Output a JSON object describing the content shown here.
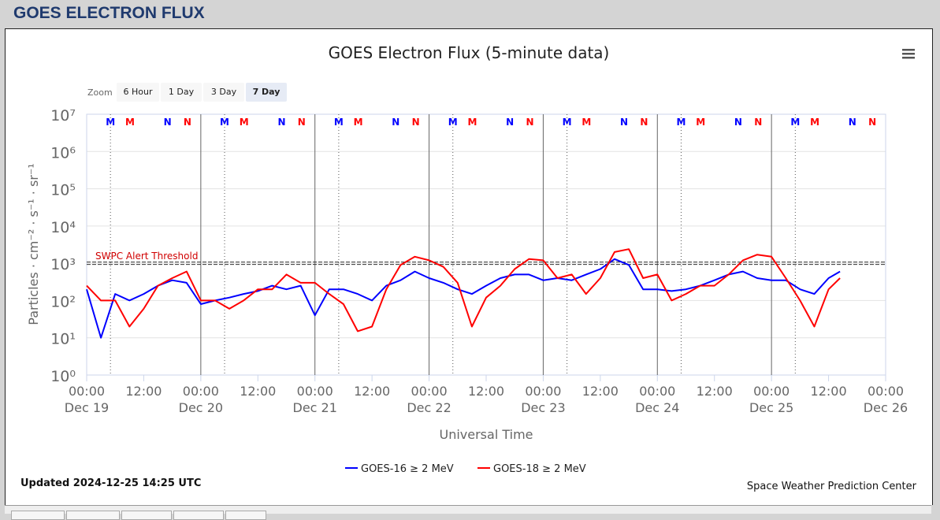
{
  "header": {
    "title": "GOES ELECTRON FLUX"
  },
  "menu_icon": "hamburger-menu-icon",
  "zoom": {
    "label": "Zoom",
    "buttons": [
      "6 Hour",
      "1 Day",
      "3 Day",
      "7 Day"
    ],
    "selected": "7 Day"
  },
  "footer": {
    "updated": "Updated 2024-12-25 14:25 UTC",
    "credit": "Space Weather Prediction Center"
  },
  "chart_data": {
    "type": "line",
    "title": "GOES Electron Flux (5-minute data)",
    "xlabel": "Universal Time",
    "ylabel": "Particles · cm⁻² · s⁻¹ · sr⁻¹",
    "yscale": "log",
    "ylim": [
      1,
      10000000
    ],
    "y_ticks": [
      "10⁰",
      "10¹",
      "10²",
      "10³",
      "10⁴",
      "10⁵",
      "10⁶",
      "10⁷"
    ],
    "xlim": [
      "2024-12-19 00:00",
      "2024-12-26 00:00"
    ],
    "x_ticks": [
      [
        "00:00",
        "Dec 19"
      ],
      [
        "12:00",
        ""
      ],
      [
        "00:00",
        "Dec 20"
      ],
      [
        "12:00",
        ""
      ],
      [
        "00:00",
        "Dec 21"
      ],
      [
        "12:00",
        ""
      ],
      [
        "00:00",
        "Dec 22"
      ],
      [
        "12:00",
        ""
      ],
      [
        "00:00",
        "Dec 23"
      ],
      [
        "12:00",
        ""
      ],
      [
        "00:00",
        "Dec 24"
      ],
      [
        "12:00",
        ""
      ],
      [
        "00:00",
        "Dec 25"
      ],
      [
        "12:00",
        ""
      ],
      [
        "00:00",
        "Dec 26"
      ]
    ],
    "grid": true,
    "threshold": {
      "label": "SWPC Alert Threshold",
      "value": 1000,
      "color": "#d00000"
    },
    "markers": [
      {
        "label": "M",
        "color": "#0000ff",
        "hour_of_day": 5,
        "dotted_line": true
      },
      {
        "label": "M",
        "color": "#ff0000",
        "hour_of_day": 9.1
      },
      {
        "label": "N",
        "color": "#0000ff",
        "hour_of_day": 17
      },
      {
        "label": "N",
        "color": "#ff0000",
        "hour_of_day": 21.2
      }
    ],
    "legend": "bottom-center",
    "x_hours_step": 3,
    "series": [
      {
        "name": "GOES-16 ≥ 2 MeV",
        "color": "#0000ff",
        "values": [
          200,
          10,
          150,
          100,
          150,
          250,
          350,
          300,
          80,
          100,
          120,
          150,
          180,
          250,
          200,
          250,
          40,
          200,
          200,
          150,
          100,
          250,
          350,
          600,
          400,
          300,
          200,
          150,
          250,
          400,
          500,
          500,
          350,
          400,
          350,
          500,
          700,
          1300,
          900,
          200,
          200,
          180,
          200,
          250,
          350,
          500,
          600,
          400,
          350,
          350,
          200,
          150,
          400,
          600
        ]
      },
      {
        "name": "GOES-18 ≥ 2 MeV",
        "color": "#ff0000",
        "values": [
          250,
          100,
          100,
          20,
          60,
          250,
          400,
          600,
          100,
          100,
          60,
          100,
          200,
          200,
          500,
          300,
          300,
          150,
          80,
          15,
          20,
          200,
          900,
          1500,
          1200,
          800,
          300,
          20,
          120,
          250,
          700,
          1300,
          1200,
          400,
          500,
          150,
          400,
          2000,
          2400,
          400,
          500,
          100,
          150,
          250,
          250,
          500,
          1200,
          1700,
          1500,
          400,
          100,
          20,
          200,
          400
        ]
      }
    ]
  }
}
